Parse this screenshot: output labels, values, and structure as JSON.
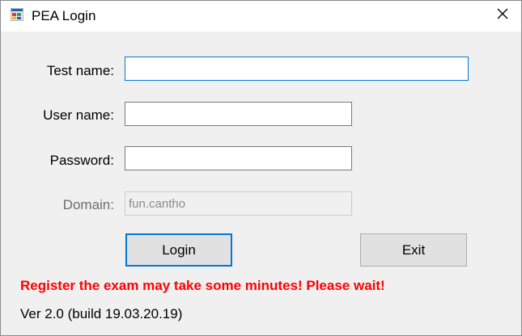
{
  "window": {
    "title": "PEA Login",
    "icon": "windows-app-icon",
    "close_glyph": "✕"
  },
  "form": {
    "test_name_label": "Test name:",
    "test_name_value": "",
    "user_name_label": "User name:",
    "user_name_value": "",
    "password_label": "Password:",
    "password_value": "",
    "domain_label": "Domain:",
    "domain_value": "fun.cantho"
  },
  "buttons": {
    "login_label": "Login",
    "exit_label": "Exit"
  },
  "status": {
    "warning_text": "Register the exam may take some minutes! Please wait!",
    "warning_color": "#ff0000",
    "version_text": "Ver 2.0 (build 19.03.20.19)"
  },
  "colors": {
    "focus_accent": "#0078d7",
    "window_bg": "#f0f0f0"
  }
}
